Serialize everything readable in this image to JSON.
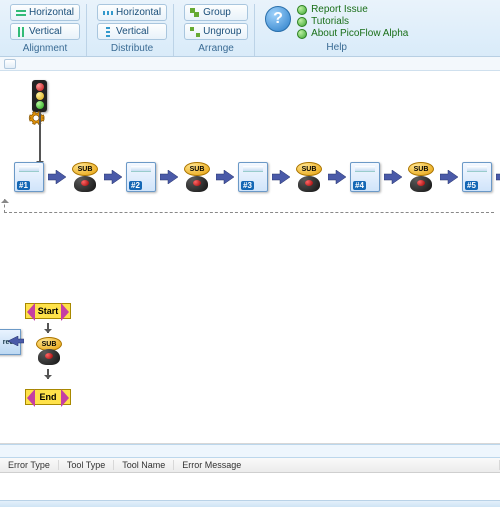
{
  "ribbon": {
    "alignment": {
      "label": "Alignment",
      "horizontal": "Horizontal",
      "vertical": "Vertical"
    },
    "distribute": {
      "label": "Distribute",
      "horizontal": "Horizontal",
      "vertical": "Vertical"
    },
    "arrange": {
      "label": "Arrange",
      "group": "Group",
      "ungroup": "Ungroup"
    },
    "help": {
      "label": "Help",
      "report": "Report Issue",
      "tutorials": "Tutorials",
      "about": "About PicoFlow Alpha"
    }
  },
  "flow": {
    "sub_label": "SUB",
    "nodes": [
      "#1",
      "#2",
      "#3",
      "#4",
      "#5"
    ]
  },
  "subflow": {
    "start": "Start",
    "end": "End",
    "side_label": "rec"
  },
  "grid": {
    "columns": [
      "Error Type",
      "Tool Type",
      "Tool Name",
      "Error Message"
    ]
  }
}
